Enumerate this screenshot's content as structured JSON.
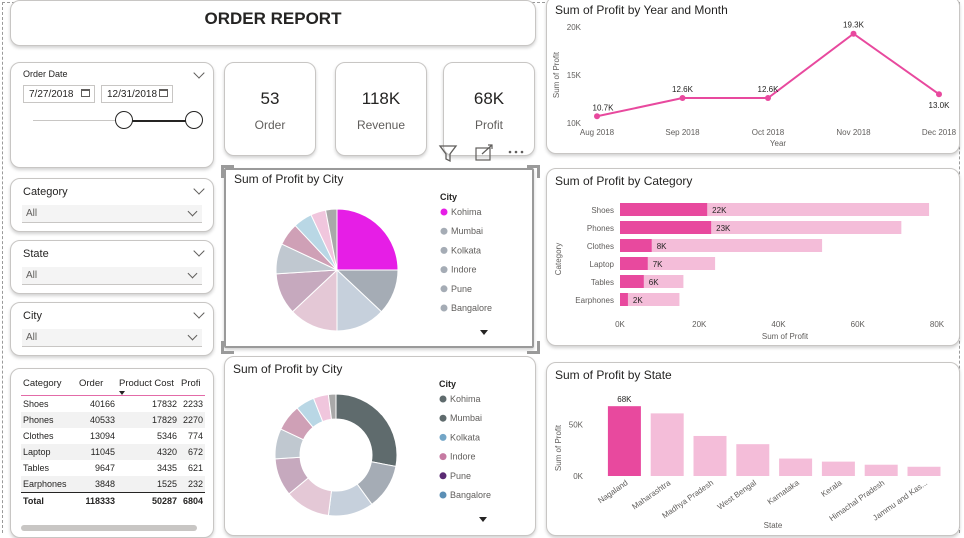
{
  "report_title": "ORDER REPORT",
  "slicers": {
    "order_date": {
      "label": "Order Date",
      "start": "7/27/2018",
      "end": "12/31/2018"
    },
    "category": {
      "label": "Category",
      "value": "All"
    },
    "state": {
      "label": "State",
      "value": "All"
    },
    "city": {
      "label": "City",
      "value": "All"
    }
  },
  "kpis": [
    {
      "value": "53",
      "label": "Order"
    },
    {
      "value": "118K",
      "label": "Revenue"
    },
    {
      "value": "68K",
      "label": "Profit"
    }
  ],
  "table": {
    "headers": [
      "Category",
      "Order",
      "Product Cost",
      "Profi"
    ],
    "rows": [
      [
        "Shoes",
        "40166",
        "17832",
        "2233"
      ],
      [
        "Phones",
        "40533",
        "17829",
        "2270"
      ],
      [
        "Clothes",
        "13094",
        "5346",
        "774"
      ],
      [
        "Laptop",
        "11045",
        "4320",
        "672"
      ],
      [
        "Tables",
        "9647",
        "3435",
        "621"
      ],
      [
        "Earphones",
        "3848",
        "1525",
        "232"
      ]
    ],
    "total": [
      "Total",
      "118333",
      "50287",
      "6804"
    ]
  },
  "colors": {
    "accent": "#e8499e",
    "pink_dark": "#e8499e",
    "pink_light": "#f4bdd9",
    "line": "#e8499e",
    "magenta": "#e61ee6"
  },
  "chart_data": [
    {
      "type": "line",
      "title": "Sum of Profit by Year and Month",
      "xlabel": "Year",
      "ylabel": "Sum of Profit",
      "categories": [
        "Aug 2018",
        "Sep 2018",
        "Oct 2018",
        "Nov 2018",
        "Dec 2018"
      ],
      "values": [
        10700,
        12600,
        12600,
        19300,
        13000
      ],
      "data_labels": [
        "10.7K",
        "12.6K",
        "12.6K",
        "19.3K",
        "13.0K"
      ],
      "yticks": [
        "10K",
        "15K",
        "20K"
      ],
      "ylim": [
        10000,
        20000
      ]
    },
    {
      "type": "pie",
      "title": "Sum of Profit by City",
      "legend_title": "City",
      "legend": [
        "Kohima",
        "Mumbai",
        "Kolkata",
        "Indore",
        "Pune",
        "Bangalore"
      ],
      "slices": [
        {
          "color": "#e61ee6",
          "value": 25
        },
        {
          "color": "#a5acb5",
          "value": 12
        },
        {
          "color": "#c6d0dc",
          "value": 13
        },
        {
          "color": "#e4c8d6",
          "value": 13
        },
        {
          "color": "#c6a9be",
          "value": 11
        },
        {
          "color": "#c0c8d0",
          "value": 8
        },
        {
          "color": "#cfa0b6",
          "value": 6
        },
        {
          "color": "#b9d7e5",
          "value": 5
        },
        {
          "color": "#f0c6dd",
          "value": 4
        },
        {
          "color": "#a9a9a9",
          "value": 3
        }
      ]
    },
    {
      "type": "bar",
      "title": "Sum of Profit by Category",
      "xlabel": "Sum of Profit",
      "ylabel": "Category",
      "categories": [
        "Shoes",
        "Phones",
        "Clothes",
        "Laptop",
        "Tables",
        "Earphones"
      ],
      "values": [
        22000,
        23000,
        8000,
        7000,
        6000,
        2000
      ],
      "data_labels": [
        "22K",
        "23K",
        "8K",
        "7K",
        "6K",
        "2K"
      ],
      "background_values": [
        78000,
        71000,
        51000,
        24000,
        16000,
        15000
      ],
      "xticks": [
        "0K",
        "20K",
        "40K",
        "60K",
        "80K"
      ],
      "xlim": [
        0,
        80000
      ]
    },
    {
      "type": "pie",
      "title": "Sum of Profit by City",
      "legend_title": "City",
      "legend": [
        "Kohima",
        "Mumbai",
        "Kolkata",
        "Indore",
        "Pune",
        "Bangalore"
      ],
      "slices": [
        {
          "color": "#5f6b6d",
          "value": 28
        },
        {
          "color": "#a5acb5",
          "value": 12
        },
        {
          "color": "#c6d0dc",
          "value": 12
        },
        {
          "color": "#e4c8d6",
          "value": 12
        },
        {
          "color": "#c6a9be",
          "value": 10
        },
        {
          "color": "#c0c8d0",
          "value": 8
        },
        {
          "color": "#cfa0b6",
          "value": 7
        },
        {
          "color": "#b9d7e5",
          "value": 5
        },
        {
          "color": "#f0c6dd",
          "value": 4
        },
        {
          "color": "#a9a9a9",
          "value": 2
        }
      ],
      "legend_colors": [
        "#5f6b6d",
        "#5f6b6d",
        "#73a6c7",
        "#c67aa2",
        "#5a2a73",
        "#5b8fb5"
      ]
    },
    {
      "type": "bar",
      "title": "Sum of Profit by State",
      "xlabel": "State",
      "ylabel": "Sum of Profit",
      "categories": [
        "Nagaland",
        "Maharashtra",
        "Madhya Pradesh",
        "West Bengal",
        "Karnataka",
        "Kerala",
        "Himachal Pradesh",
        "Jammu and Kas..."
      ],
      "values": [
        68000,
        61000,
        39000,
        31000,
        17000,
        14000,
        11000,
        9000
      ],
      "data_labels": [
        "68K",
        "",
        "",
        "",
        "",
        "",
        "",
        ""
      ],
      "yticks": [
        "0K",
        "50K"
      ],
      "ylim": [
        0,
        75000
      ]
    }
  ],
  "legend_colors_1": [
    "#e61ee6",
    "#a5acb5",
    "#a5acb5",
    "#a5acb5",
    "#a5acb5",
    "#a5acb5"
  ]
}
